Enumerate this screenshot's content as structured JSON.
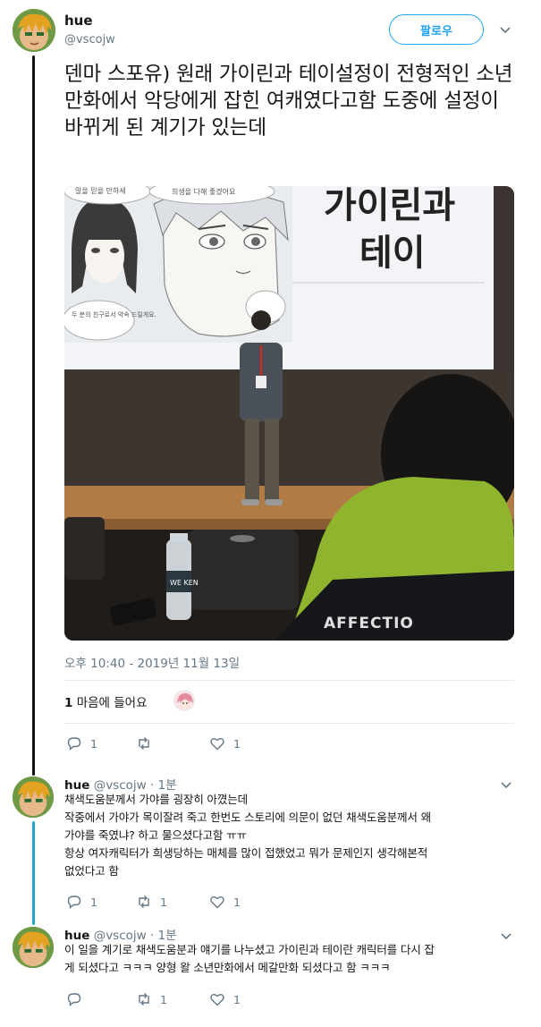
{
  "main_tweet": {
    "name": "hue",
    "handle": "@vscojw",
    "follow_label": "팔로우",
    "text": "덴마 스포유) 원래 가이린과 테이설정이 전형적인 소년만화에서 악당에게 잡힌 여캐였다고함 도중에 설정이 바뀌게 된 계기가 있는데",
    "photo": {
      "slide_title_line1": "가이린과",
      "slide_title_line2": "테이",
      "bubble_top_left": "말을 믿을 만하세",
      "bubble_top_mid": "희생을 다해 좋겠어요",
      "bubble_bottom_left": "두 분의 친구로서 약속 드릴게요.",
      "hoodie_text": "AFFECTIO",
      "bottle_text": "WE KEN"
    },
    "timestamp": "오후 10:40 - 2019년 11월 13일",
    "likes_count": "1",
    "likes_label": "마음에 들어요",
    "actions": {
      "replies": "1",
      "retweets": "",
      "likes": "1"
    }
  },
  "replies": [
    {
      "name": "hue",
      "meta": "@vscojw · 1분",
      "text_lines": [
        "채색도움분께서 가야를 굉장히 아꼈는데",
        "작중에서 가야가 목이잘려 죽고 한번도 스토리에 의문이 없던 채색도움분께서 왜",
        "가야를 죽였냐? 하고 물으셨다고함 ㅠㅠ",
        "항상 여자캐릭터가 희생당하는 매체를 많이 접했었고 뭐가 문제인지 생각해본적",
        "없었다고 함"
      ],
      "actions": {
        "replies": "1",
        "retweets": "1",
        "likes": "1"
      }
    },
    {
      "name": "hue",
      "meta": "@vscojw · 1분",
      "text_lines": [
        "이 일을 계기로 채색도움분과 얘기를 나누셨고 가이린과 테이란 캐릭터를 다시 잡",
        "게 되셨다고 ㅋㅋㅋ 양형 왈 소년만화에서 메갈만화 되셨다고 함 ㅋㅋㅋ"
      ],
      "actions": {
        "replies": "",
        "retweets": "1",
        "likes": "1"
      }
    }
  ],
  "icons": {
    "reply": "reply-icon",
    "retweet": "retweet-icon",
    "like": "heart-icon",
    "caret": "chevron-down-icon"
  },
  "colors": {
    "accent": "#1da1f2",
    "thread_line_main": "#111111",
    "thread_line_reply": "#2ea5c6",
    "muted": "#657786"
  }
}
